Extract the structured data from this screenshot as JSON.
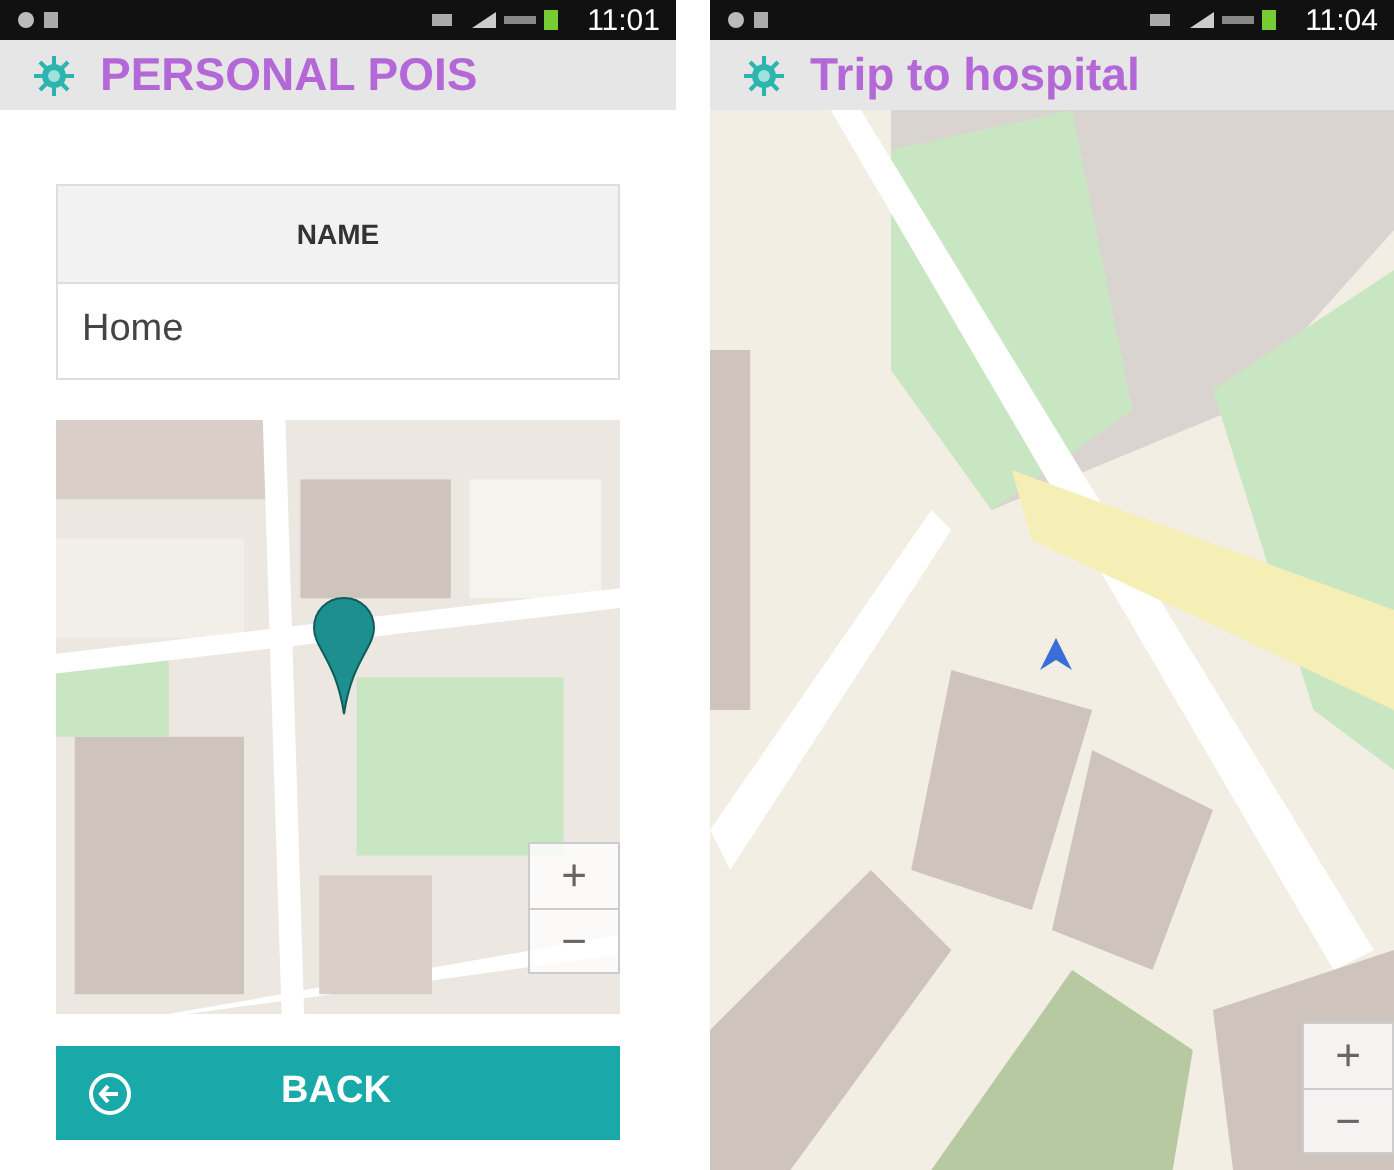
{
  "screens": [
    {
      "status_bar": {
        "time": "11:01"
      },
      "title": "PERSONAL POIS",
      "form": {
        "header": "NAME",
        "value": "Home"
      },
      "map": {
        "kind": "picture",
        "zoom_in": "+",
        "zoom_out": "−"
      },
      "back_button": {
        "label": "BACK"
      }
    },
    {
      "status_bar": {
        "time": "11:04"
      },
      "title": "Trip to hospital",
      "map": {
        "kind": "picture",
        "zoom_in": "+",
        "zoom_out": "−"
      }
    }
  ]
}
